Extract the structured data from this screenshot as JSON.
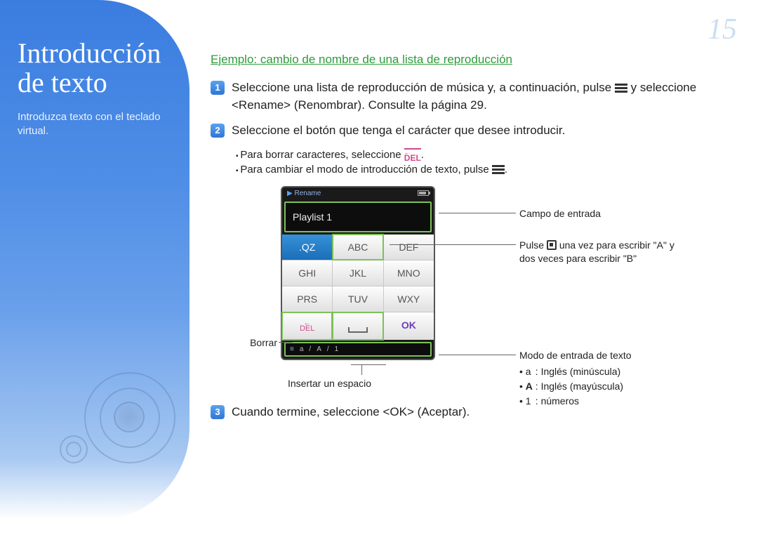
{
  "page_number": "15",
  "sidebar": {
    "title": "Introducción de texto",
    "subtitle": "Introduzca texto con el teclado virtual."
  },
  "example_title": "Ejemplo: cambio de nombre de una lista de reproducción",
  "steps": {
    "s1": "Seleccione una lista de reproducción de música y, a continuación, pulse",
    "s1b": "y seleccione <Rename> (Renombrar). Consulte la página 29.",
    "s2": "Seleccione el botón que tenga el carácter que desee introducir.",
    "s3": "Cuando termine, seleccione <OK> (Aceptar)."
  },
  "bullets": {
    "b1": "Para borrar caracteres, seleccione",
    "b2": "Para cambiar el modo de introducción de texto, pulse"
  },
  "phone": {
    "header": "Rename",
    "field": "Playlist 1",
    "keys": {
      "k1": ".QZ",
      "k2": "ABC",
      "k3": "DEF",
      "k4": "GHI",
      "k5": "JKL",
      "k6": "MNO",
      "k7": "PRS",
      "k8": "TUV",
      "k9": "WXY",
      "k10": "DEL",
      "k11": "",
      "k12": "OK"
    }
  },
  "callouts": {
    "field": "Campo de entrada",
    "abc_line1": "Pulse",
    "abc_line2": "una vez para escribir \"A\" y dos veces para escribir \"B\"",
    "borrar": "Borrar",
    "insert": "Insertar un espacio",
    "mode_title": "Modo de entrada de texto",
    "mode_lower": ": Inglés (minúscula)",
    "mode_upper": ": Inglés (mayúscula)",
    "mode_num": ": números"
  }
}
